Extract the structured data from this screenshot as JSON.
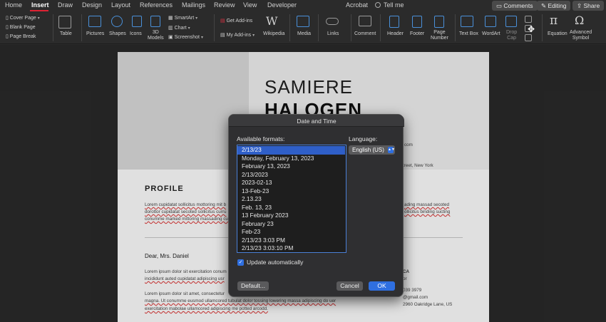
{
  "menu": {
    "tabs": [
      "Home",
      "Insert",
      "Draw",
      "Design",
      "Layout",
      "References",
      "Mailings",
      "Review",
      "View",
      "Developer",
      "Acrobat"
    ],
    "active": "Insert",
    "tell_me": "Tell me",
    "comments": "Comments",
    "editing": "Editing",
    "share": "Share"
  },
  "ribbon": {
    "pages": [
      "Cover Page",
      "Blank Page",
      "Page Break"
    ],
    "table": "Table",
    "pictures": "Pictures",
    "shapes": "Shapes",
    "icons": "Icons",
    "models3d": "3D\nModels",
    "smartart": "SmartArt",
    "chart": "Chart",
    "screenshot": "Screenshot",
    "get_addins": "Get Add-ins",
    "my_addins": "My Add-ins",
    "wikipedia": "Wikipedia",
    "media": "Media",
    "links": "Links",
    "comment": "Comment",
    "header": "Header",
    "footer": "Footer",
    "page_number": "Page\nNumber",
    "text_box": "Text Box",
    "wordart": "WordArt",
    "drop_cap": "Drop\nCap",
    "equation": "Equation",
    "advanced_symbol": "Advanced\nSymbol"
  },
  "document": {
    "name_first": "SAMIERE",
    "name_last": "HALOGEN",
    "profile_heading": "PROFILE",
    "greeting": "Dear, Mrs. Daniel",
    "right_snippets": [
      "com",
      "treet, New York",
      "ading massad secoted",
      "ollicitus binding sucting",
      "CA",
      "or",
      "039  3979",
      "@gmail.com",
      "2960 Oakridge Lane, US"
    ],
    "profile_lines": [
      "Lorem cupidatat sollicitus mottoring mit b",
      "dorottor cupidatat secoted sollicitus curru",
      "conumme marked mittoring massading cum"
    ],
    "body_lines": [
      "Lorem ipsum dolor sit exercitation conum",
      "incididunt auted cupidatat adipiscing usr",
      "Lorem ipsum dolor sit amet, consectetur",
      "magna. Ut conumme eusmod ullamcored tubulat dolor tossing lowering massa adipiscing do uer",
      "exercitation mabolae ullamcored adipiscing me potted arcodd."
    ]
  },
  "dialog": {
    "title": "Date and Time",
    "formats_label": "Available formats:",
    "language_label": "Language:",
    "language_value": "English (US)",
    "formats": [
      "2/13/23",
      "Monday, February 13, 2023",
      "February 13, 2023",
      "2/13/2023",
      "2023-02-13",
      "13-Feb-23",
      "2.13.23",
      "Feb. 13, 23",
      "13 February 2023",
      "February 23",
      "Feb-23",
      "2/13/23 3:03 PM",
      "2/13/23 3:03:10 PM"
    ],
    "selected_index": 0,
    "update_automatically": "Update automatically",
    "update_checked": true,
    "default_button": "Default...",
    "cancel_button": "Cancel",
    "ok_button": "OK"
  }
}
